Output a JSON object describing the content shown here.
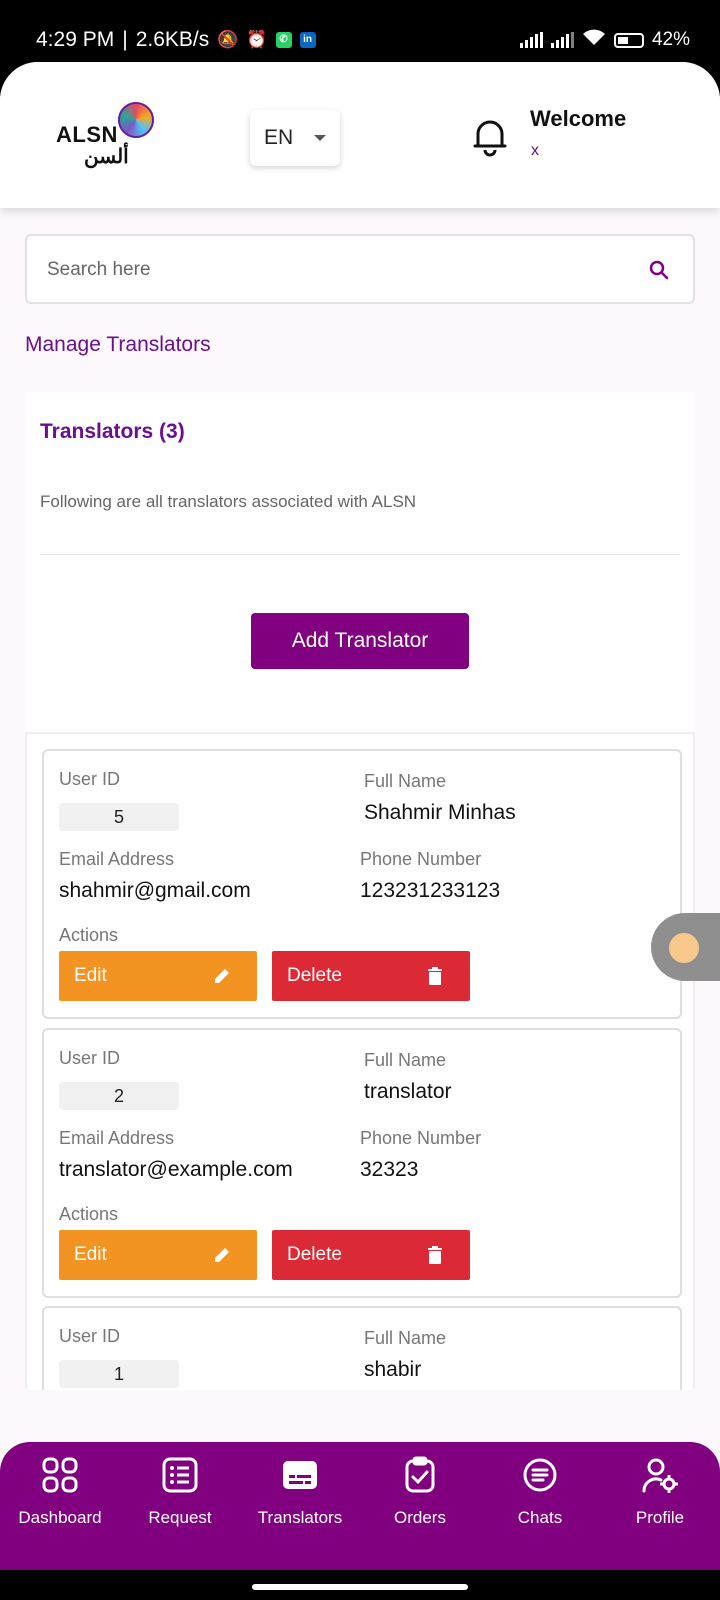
{
  "status_bar": {
    "time": "4:29 PM",
    "net_speed": "2.6KB/s",
    "battery": "42%"
  },
  "header": {
    "logo_text": "ALSN",
    "logo_arabic": "ألسن",
    "language": "EN",
    "welcome": "Welcome",
    "user_name": "x"
  },
  "search": {
    "placeholder": "Search here"
  },
  "page": {
    "section_title": "Manage Translators"
  },
  "panel": {
    "title": "Translators (3)",
    "description": "Following are all translators associated with ALSN",
    "add_button": "Add Translator"
  },
  "labels": {
    "user_id": "User ID",
    "full_name": "Full Name",
    "email": "Email Address",
    "phone": "Phone Number",
    "actions": "Actions",
    "edit": "Edit",
    "delete": "Delete"
  },
  "translators": [
    {
      "id": "5",
      "name": "Shahmir Minhas",
      "email": "shahmir@gmail.com",
      "phone": "123231233123"
    },
    {
      "id": "2",
      "name": "translator",
      "email": "translator@example.com",
      "phone": "32323"
    },
    {
      "id": "1",
      "name": "shabir",
      "email": "",
      "phone": ""
    }
  ],
  "bottom_nav": [
    {
      "label": "Dashboard",
      "icon": "grid-icon"
    },
    {
      "label": "Request",
      "icon": "list-icon"
    },
    {
      "label": "Translators",
      "icon": "subtitles-icon"
    },
    {
      "label": "Orders",
      "icon": "clipboard-check-icon"
    },
    {
      "label": "Chats",
      "icon": "chat-icon"
    },
    {
      "label": "Profile",
      "icon": "user-settings-icon"
    }
  ],
  "colors": {
    "primary": "#800080",
    "edit": "#f39322",
    "delete": "#db2a35"
  }
}
